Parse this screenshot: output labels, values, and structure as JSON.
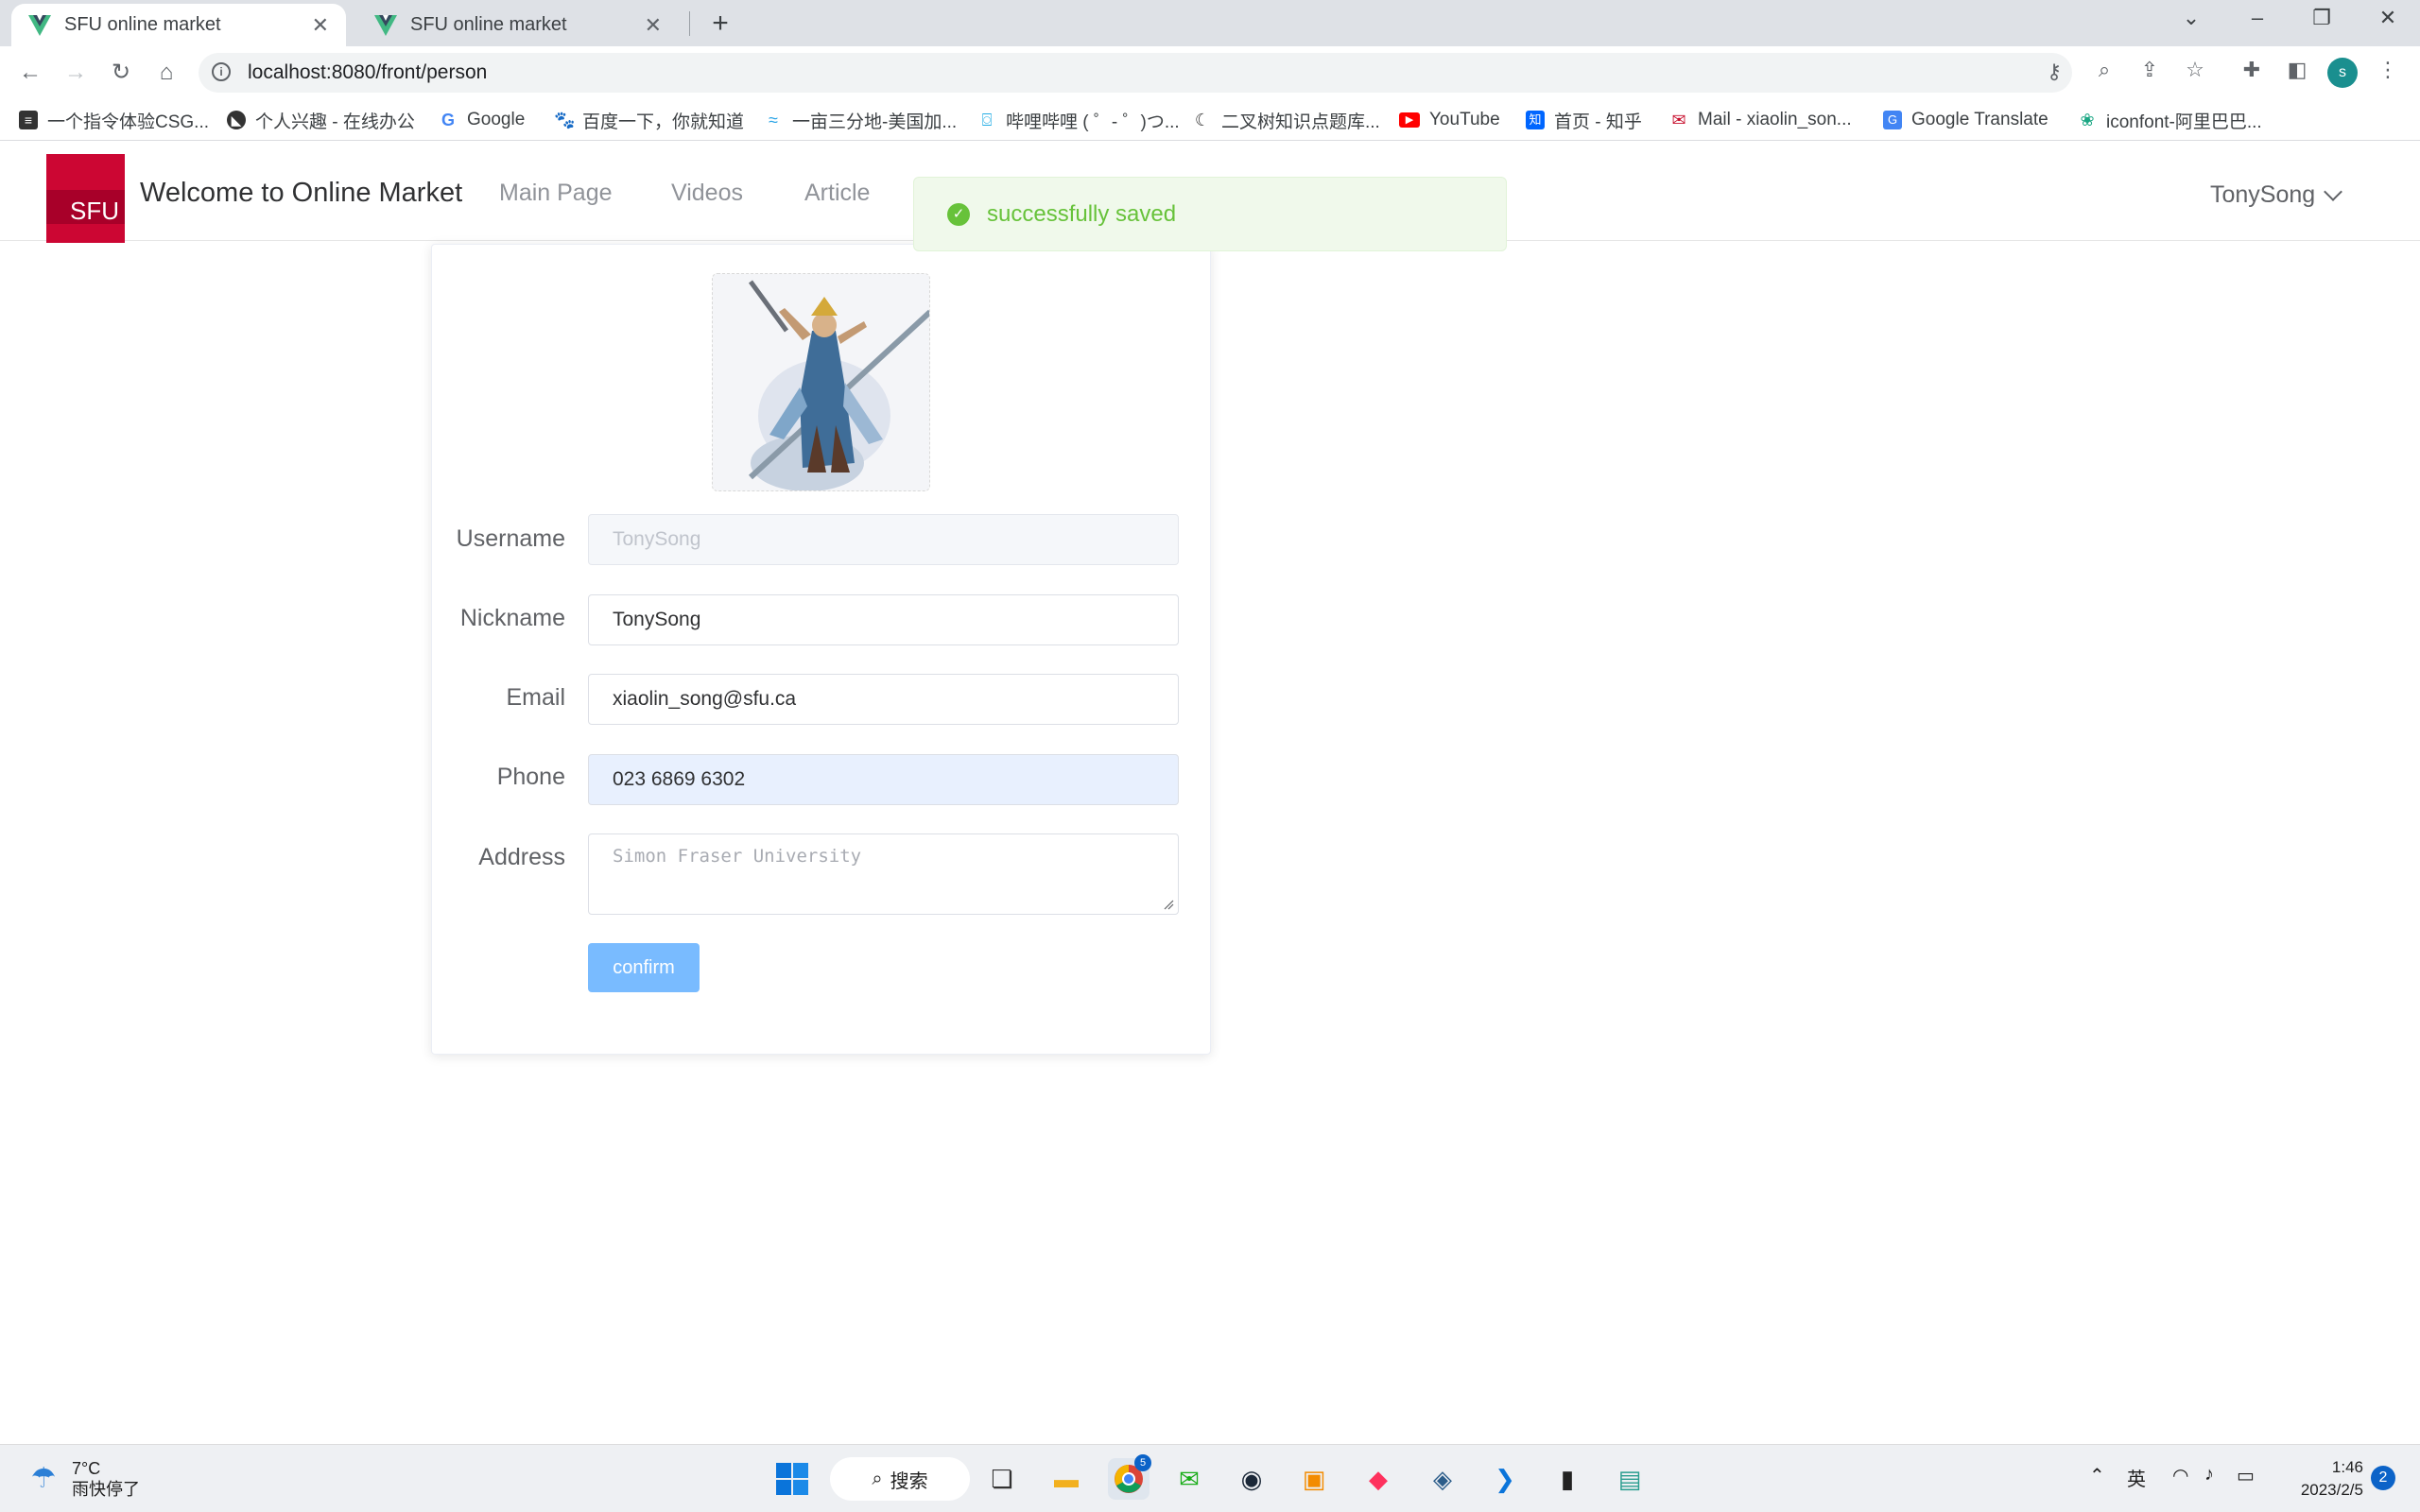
{
  "browser": {
    "tabs": [
      {
        "title": "SFU online market",
        "active": true
      },
      {
        "title": "SFU online market",
        "active": false
      }
    ],
    "url": "localhost:8080/front/person",
    "profile_initial": "s",
    "bookmarks": [
      {
        "label": "一个指令体验CSG...",
        "icon": "csg-icon",
        "color": "#333333"
      },
      {
        "label": "个人兴趣 - 在线办公",
        "icon": "compass-icon",
        "color": "#333333"
      },
      {
        "label": "Google",
        "icon": "google-icon",
        "color": "#4285f4"
      },
      {
        "label": "百度一下，你就知道",
        "icon": "baidu-icon",
        "color": "#2932e1"
      },
      {
        "label": "一亩三分地-美国加...",
        "icon": "1point3acres-icon",
        "color": "#2aa4e6"
      },
      {
        "label": "哔哩哔哩 ( ゜- ゜)つ...",
        "icon": "bilibili-icon",
        "color": "#23ade5"
      },
      {
        "label": "二叉树知识点题库...",
        "icon": "tree-icon",
        "color": "#e8710a"
      },
      {
        "label": "YouTube",
        "icon": "youtube-icon",
        "color": "#ff0000"
      },
      {
        "label": "首页 - 知乎",
        "icon": "zhihu-icon",
        "color": "#0066ff"
      },
      {
        "label": "Mail - xiaolin_son...",
        "icon": "mail-icon",
        "color": "#c8102e"
      },
      {
        "label": "Google Translate",
        "icon": "translate-icon",
        "color": "#4285f4"
      },
      {
        "label": "iconfont-阿里巴巴...",
        "icon": "iconfont-icon",
        "color": "#1ba784"
      }
    ]
  },
  "header": {
    "logo_text": "SFU",
    "site_title": "Welcome to Online Market",
    "menu": [
      "Main Page",
      "Videos",
      "Article"
    ],
    "user_name": "TonySong"
  },
  "toast": {
    "message": "successfully saved",
    "type": "success"
  },
  "form": {
    "username": {
      "label": "Username",
      "value": "TonySong"
    },
    "nickname": {
      "label": "Nickname",
      "value": "TonySong"
    },
    "email": {
      "label": "Email",
      "value": "xiaolin_song@sfu.ca"
    },
    "phone": {
      "label": "Phone",
      "value": "023 6869 6302"
    },
    "address": {
      "label": "Address",
      "value": "Simon Fraser University"
    },
    "confirm_label": "confirm"
  },
  "taskbar": {
    "weather_temp": "7°C",
    "weather_desc": "雨快停了",
    "search_label": "搜索",
    "ime": "英",
    "time": "1:46",
    "date": "2023/2/5",
    "notification_count": "2",
    "chrome_badge": "5"
  },
  "colors": {
    "brand_red": "#cc0633",
    "success_green": "#67c23a",
    "primary_light": "#79bbff"
  }
}
